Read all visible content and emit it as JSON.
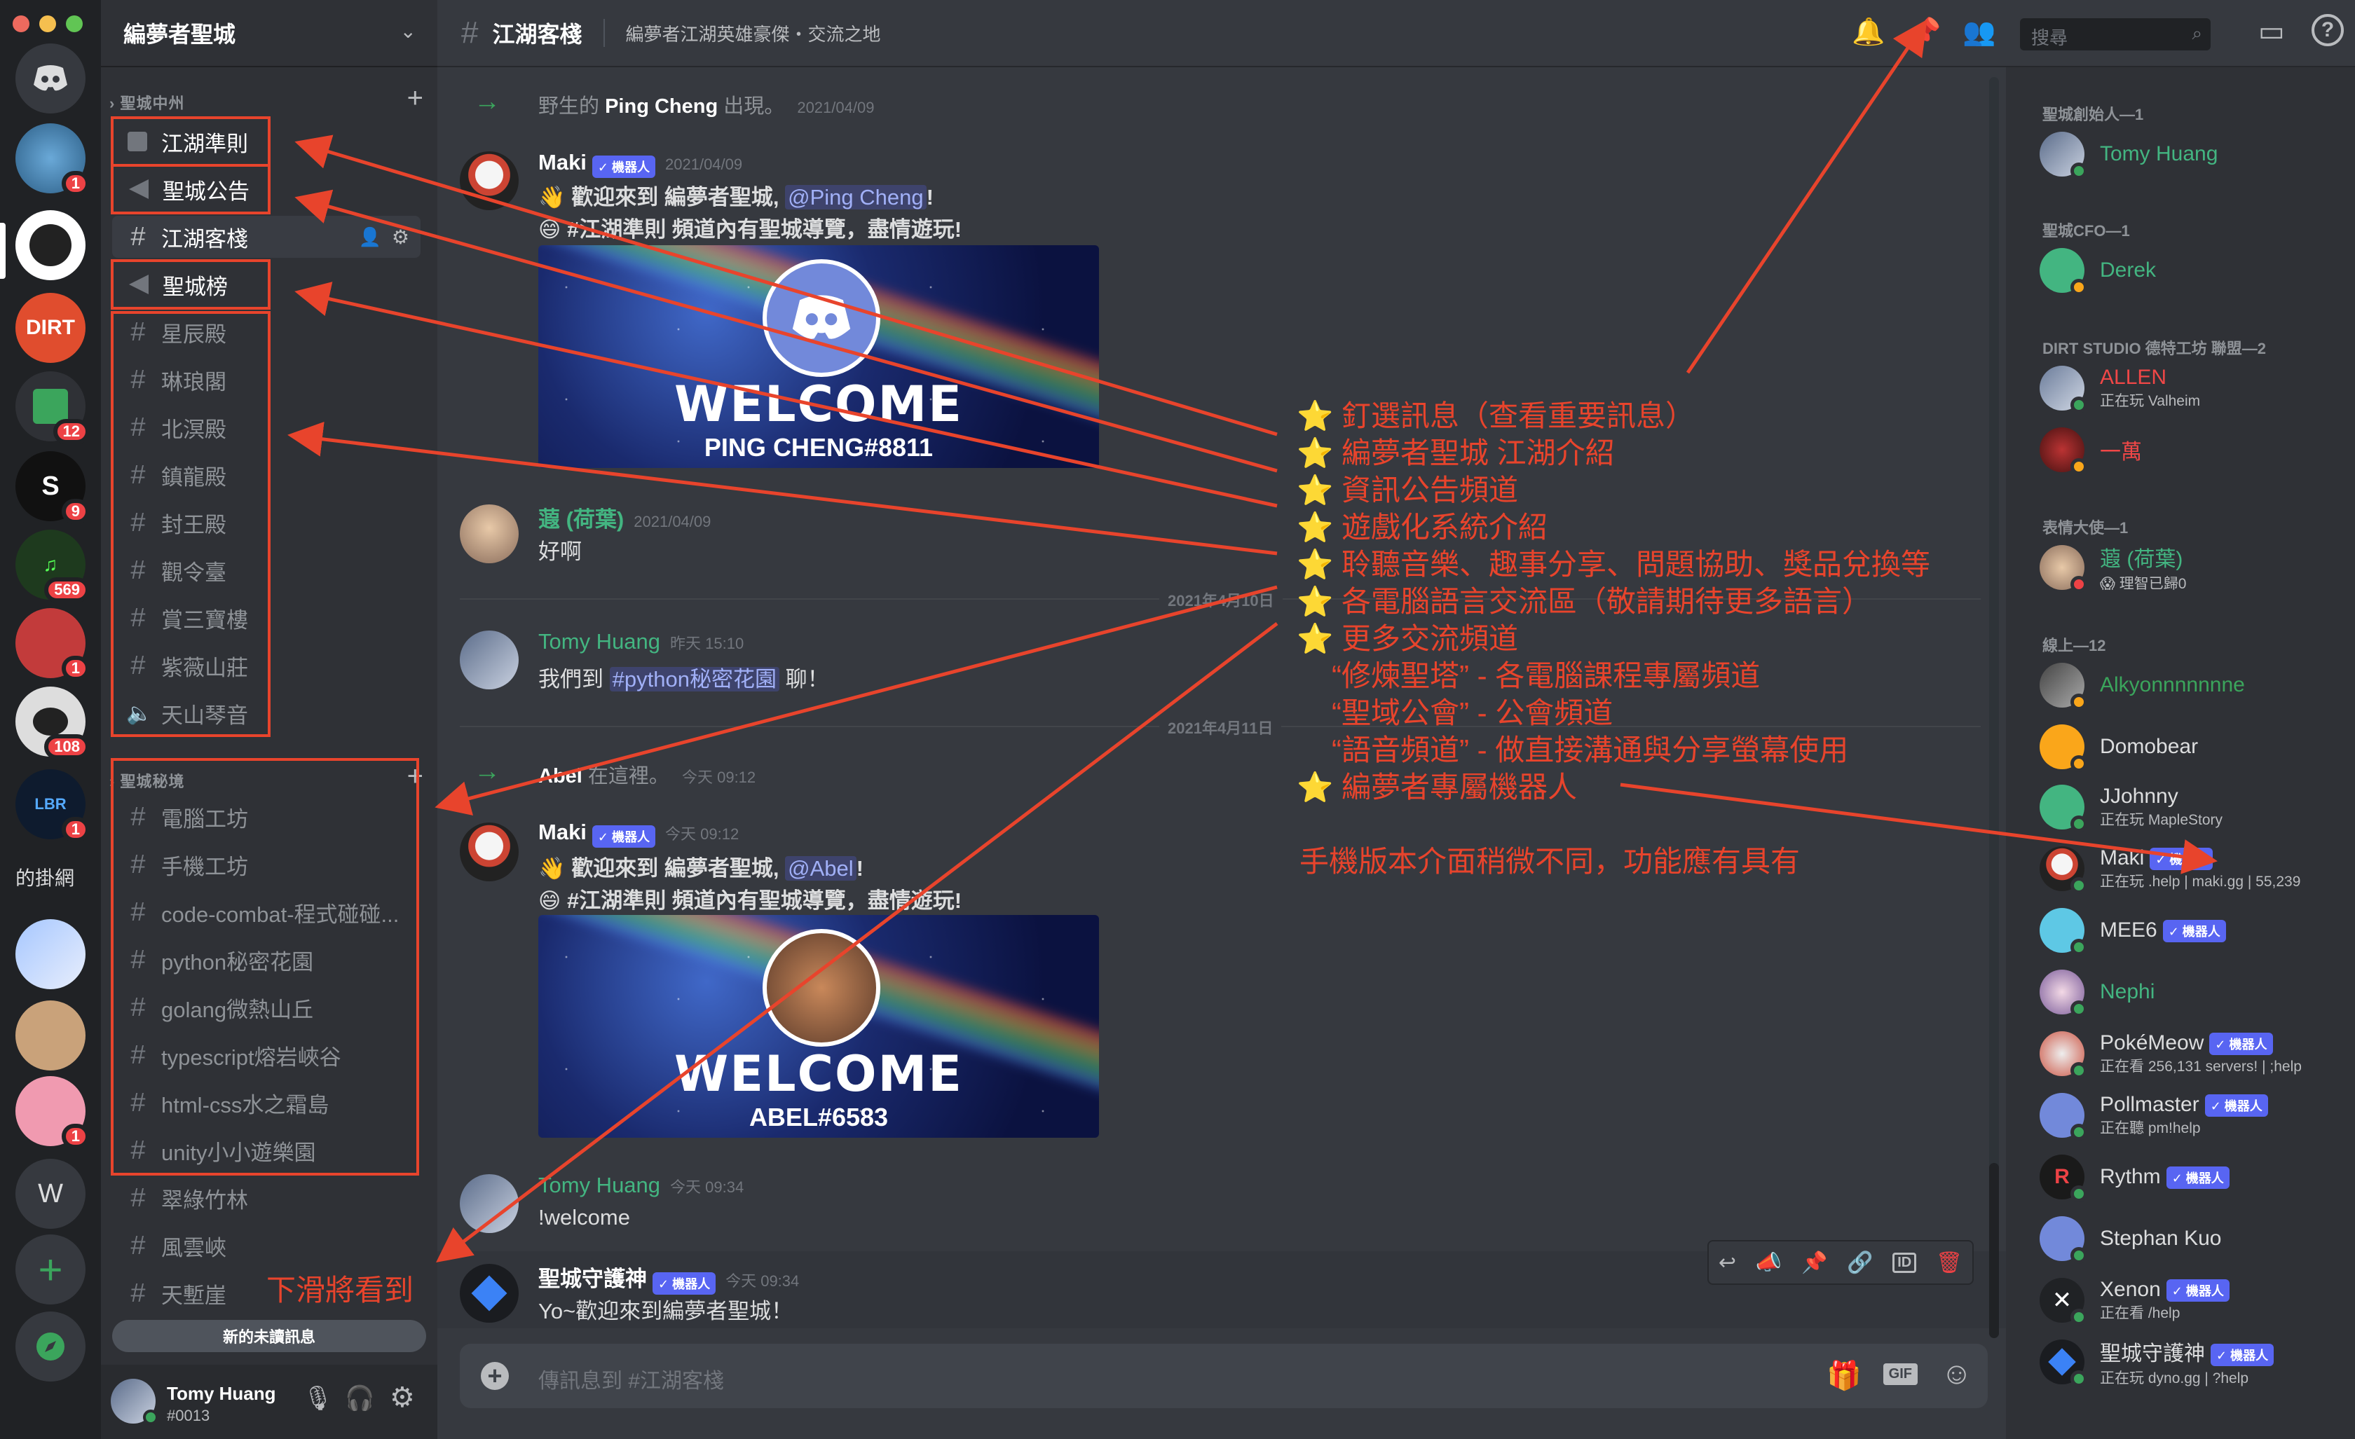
{
  "rail": {
    "badges": [
      "1",
      "12",
      "9",
      "569",
      "1",
      "108",
      "1",
      "1"
    ],
    "text_server": "的掛網",
    "w_server": "W"
  },
  "guild": {
    "name": "編夢者聖城",
    "categories": [
      {
        "label": "聖城中州"
      },
      {
        "label": "聖城秘境"
      }
    ],
    "channels_top": [
      {
        "label": "江湖準則",
        "kind": "rules"
      },
      {
        "label": "聖城公告",
        "kind": "announce"
      },
      {
        "label": "江湖客棧",
        "kind": "text",
        "active": true
      },
      {
        "label": "聖城榜",
        "kind": "announce"
      },
      {
        "label": "星辰殿",
        "kind": "text"
      },
      {
        "label": "琳琅閣",
        "kind": "text"
      },
      {
        "label": "北溟殿",
        "kind": "text"
      },
      {
        "label": "鎮龍殿",
        "kind": "text"
      },
      {
        "label": "封王殿",
        "kind": "text"
      },
      {
        "label": "觀令臺",
        "kind": "text"
      },
      {
        "label": "賞三寶樓",
        "kind": "text"
      },
      {
        "label": "紫薇山莊",
        "kind": "text"
      },
      {
        "label": "天山琴音",
        "kind": "voice"
      }
    ],
    "channels_secret": [
      {
        "label": "電腦工坊"
      },
      {
        "label": "手機工坊"
      },
      {
        "label": "code-combat-程式碰碰..."
      },
      {
        "label": "python秘密花園"
      },
      {
        "label": "golang微熱山丘"
      },
      {
        "label": "typescript熔岩峽谷"
      },
      {
        "label": "html-css水之霜島"
      },
      {
        "label": "unity小小遊樂園"
      }
    ],
    "channels_more": [
      {
        "label": "翠綠竹林"
      },
      {
        "label": "風雲峽"
      },
      {
        "label": "天塹崖"
      }
    ],
    "new_unread": "新的未讀訊息",
    "user": {
      "name": "Tomy Huang",
      "tag": "#0013"
    }
  },
  "topbar": {
    "channel": "江湖客棧",
    "topic": "編夢者江湖英雄豪傑・交流之地",
    "search_placeholder": "搜尋"
  },
  "messages": {
    "join1": {
      "prefix": "野生的",
      "name": "Ping Cheng",
      "suffix": "出現。",
      "time": "2021/04/09"
    },
    "maki1": {
      "author": "Maki",
      "bot": "✓ 機器人",
      "time": "2021/04/09",
      "line1_a": "歡迎來到 編夢者聖城,",
      "line1_mention": "@Ping Cheng",
      "line1_b": "!",
      "line2": "#江湖準則 頻道內有聖城導覽，盡情遊玩!",
      "card_title": "WELCOME",
      "card_sub": "PING CHENG#8811"
    },
    "lotus": {
      "author": "蕸 (荷葉)",
      "time": "2021/04/09",
      "text": "好啊"
    },
    "divider1": "2021年4月10日",
    "tomy1": {
      "author": "Tomy Huang",
      "time": "昨天 15:10",
      "text_a": "我們到",
      "mention": "#python秘密花園",
      "text_b": "聊！"
    },
    "divider2": "2021年4月11日",
    "join2": {
      "name": "Abel",
      "suffix": "在這裡。",
      "time": "今天 09:12"
    },
    "maki2": {
      "author": "Maki",
      "bot": "✓ 機器人",
      "time": "今天 09:12",
      "line1_a": "歡迎來到 編夢者聖城,",
      "line1_mention": "@Abel",
      "line1_b": "!",
      "line2": "#江湖準則 頻道內有聖城導覽，盡情遊玩!",
      "card_title": "WELCOME",
      "card_sub": "ABEL#6583"
    },
    "tomy2": {
      "author": "Tomy Huang",
      "time": "今天 09:34",
      "text": "!welcome"
    },
    "guard": {
      "author": "聖城守護神",
      "bot": "✓ 機器人",
      "time": "今天 09:34",
      "text": "Yo~歡迎來到編夢者聖城！"
    }
  },
  "composer": {
    "placeholder": "傳訊息到 #江湖客棧",
    "gif": "GIF"
  },
  "members": {
    "groups": [
      {
        "label": "聖城創始人—1",
        "items": [
          {
            "name": "Tomy Huang",
            "color": "#43b581"
          }
        ]
      },
      {
        "label": "聖城CFO—1",
        "items": [
          {
            "name": "Derek",
            "color": "#43b581"
          }
        ]
      },
      {
        "label": "DIRT STUDIO 德特工坊 聯盟—2",
        "items": [
          {
            "name": "ALLEN",
            "color": "#f04747",
            "sub": "正在玩 Valheim"
          },
          {
            "name": "一萬",
            "color": "#f04747"
          }
        ]
      },
      {
        "label": "表情大使—1",
        "items": [
          {
            "name": "蕸 (荷葉)",
            "color": "#43b581",
            "sub": "😱 理智已歸0"
          }
        ]
      },
      {
        "label": "線上—12",
        "items": [
          {
            "name": "Alkyonnnnnnne",
            "color": "#3ba55c"
          },
          {
            "name": "Domobear",
            "color": "#dcddde"
          },
          {
            "name": "JJohnny",
            "color": "#dcddde",
            "sub": "正在玩 MapleStory"
          },
          {
            "name": "Maki",
            "color": "#dcddde",
            "bot": "✓ 機器人",
            "sub": "正在玩 .help | maki.gg | 55,239"
          },
          {
            "name": "MEE6",
            "color": "#dcddde",
            "bot": "✓ 機器人"
          },
          {
            "name": "Nephi",
            "color": "#43b581"
          },
          {
            "name": "PokéMeow",
            "color": "#dcddde",
            "bot": "✓ 機器人",
            "sub": "正在看 256,131 servers! | ;help"
          },
          {
            "name": "Pollmaster",
            "color": "#dcddde",
            "bot": "✓ 機器人",
            "sub": "正在聽 pm!help"
          },
          {
            "name": "Rythm",
            "color": "#dcddde",
            "bot": "✓ 機器人"
          },
          {
            "name": "Stephan Kuo",
            "color": "#dcddde"
          },
          {
            "name": "Xenon",
            "color": "#dcddde",
            "bot": "✓ 機器人",
            "sub": "正在看 /help"
          },
          {
            "name": "聖城守護神",
            "color": "#dcddde",
            "bot": "✓ 機器人",
            "sub": "正在玩 dyno.gg | ?help"
          }
        ]
      }
    ]
  },
  "annotations": {
    "lines": [
      "⭐ 釘選訊息（查看重要訊息）",
      "⭐ 編夢者聖城 江湖介紹",
      "⭐ 資訊公告頻道",
      "⭐ 遊戲化系統介紹",
      "⭐ 聆聽音樂、趣事分享、問題協助、獎品兌換等",
      "⭐ 各電腦語言交流區（敬請期待更多語言）",
      "⭐ 更多交流頻道",
      "“修煉聖塔” - 各電腦課程專屬頻道",
      "“聖域公會” - 公會頻道",
      "“語音頻道” - 做直接溝通與分享螢幕使用",
      "⭐ 編夢者專屬機器人"
    ],
    "mobile_note": "手機版本介面稍微不同，功能應有具有",
    "scroll_note": "下滑將看到"
  }
}
